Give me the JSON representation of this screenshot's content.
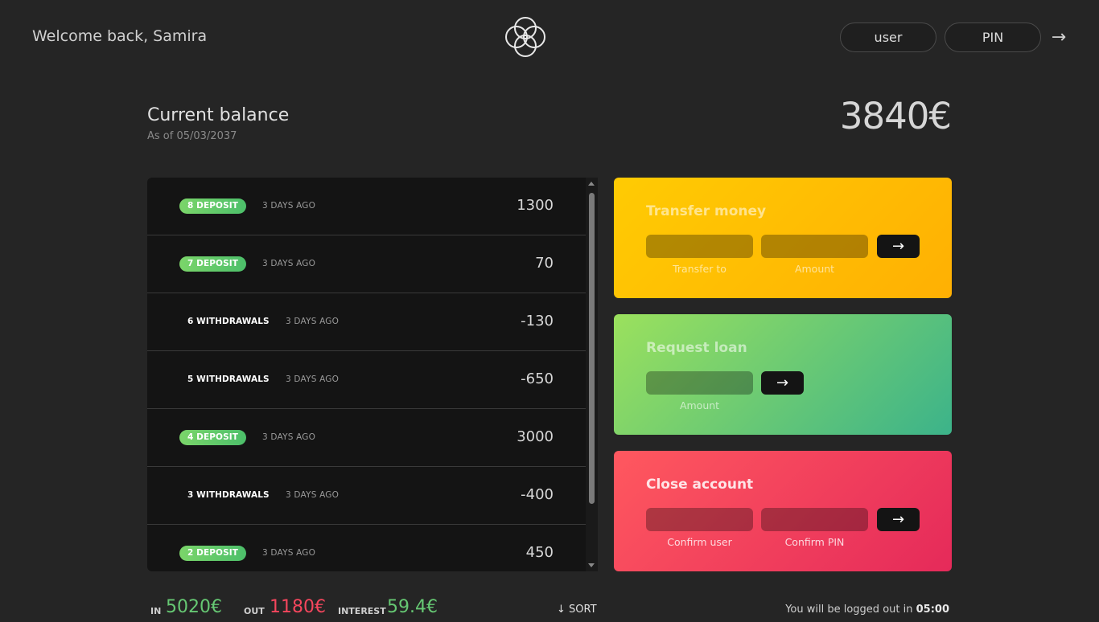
{
  "nav": {
    "welcome": "Welcome back, Samira",
    "logo_icon": "overlapping-circles-logo",
    "user_placeholder": "user",
    "pin_placeholder": "PIN",
    "login_arrow": "→"
  },
  "balance": {
    "label": "Current balance",
    "date": "As of 05/03/2037",
    "value": "3840€"
  },
  "movements": [
    {
      "type_label": "8 deposit",
      "kind": "deposit",
      "date": "3 days ago",
      "value": "1300"
    },
    {
      "type_label": "7 deposit",
      "kind": "deposit",
      "date": "3 days ago",
      "value": "70"
    },
    {
      "type_label": "6 withdrawals",
      "kind": "withdrawal",
      "date": "3 days ago",
      "value": "-130"
    },
    {
      "type_label": "5 withdrawals",
      "kind": "withdrawal",
      "date": "3 days ago",
      "value": "-650"
    },
    {
      "type_label": "4 deposit",
      "kind": "deposit",
      "date": "3 days ago",
      "value": "3000"
    },
    {
      "type_label": "3 withdrawals",
      "kind": "withdrawal",
      "date": "3 days ago",
      "value": "-400"
    },
    {
      "type_label": "2 deposit",
      "kind": "deposit",
      "date": "3 days ago",
      "value": "450"
    }
  ],
  "operations": {
    "transfer": {
      "title": "Transfer money",
      "label_to": "Transfer to",
      "label_amount": "Amount",
      "button": "→"
    },
    "loan": {
      "title": "Request loan",
      "label_amount": "Amount",
      "button": "→"
    },
    "close": {
      "title": "Close account",
      "label_user": "Confirm user",
      "label_pin": "Confirm PIN",
      "button": "→"
    }
  },
  "summary": {
    "in_label": "In",
    "in_value": "5020€",
    "out_label": "Out",
    "out_value": "1180€",
    "interest_label": "Interest",
    "interest_value": "59.4€",
    "sort_label": "↓ SORT"
  },
  "timer": {
    "text": "You will be logged out in",
    "time": "05:00"
  },
  "colors": {
    "background": "#252525",
    "deposit_badge": "#66c873",
    "out_red": "#f5465d",
    "transfer_yellow": "#ffcb03",
    "loan_green": "#9be15d",
    "close_red": "#ff585f"
  }
}
